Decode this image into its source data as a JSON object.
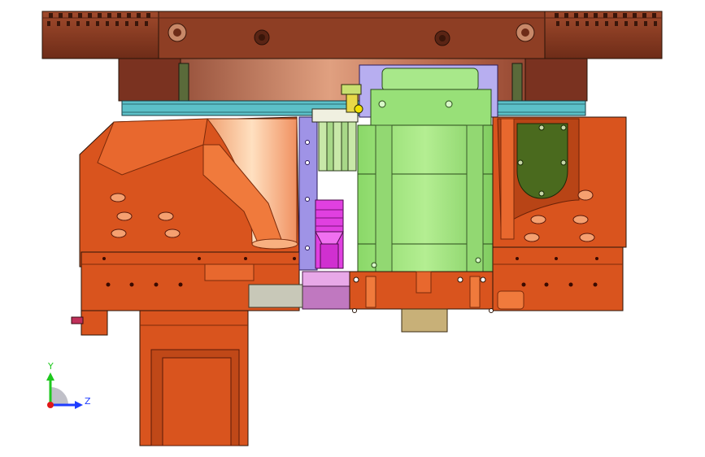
{
  "triad": {
    "y_label": "Y",
    "z_label": "Z",
    "y_color": "#1ec81e",
    "z_color": "#1e3cff",
    "origin_color": "#e01818"
  },
  "colors": {
    "background": "#ffffff",
    "flange": "#8b3a22",
    "flange_dark": "#5a2414",
    "bearing_ring": "#5cc0c8",
    "housing": "#d9541e",
    "housing_light": "#f07a3c",
    "housing_dark": "#a8390f",
    "motor": "#9ee27a",
    "motor_dark": "#5fa845",
    "frame": "#9f93e6",
    "magenta_part": "#e040e0",
    "pink_block": "#e8a8e8",
    "olive_panel": "#4a6a1e",
    "tan_block": "#c8b078",
    "outline": "#2a1408"
  }
}
